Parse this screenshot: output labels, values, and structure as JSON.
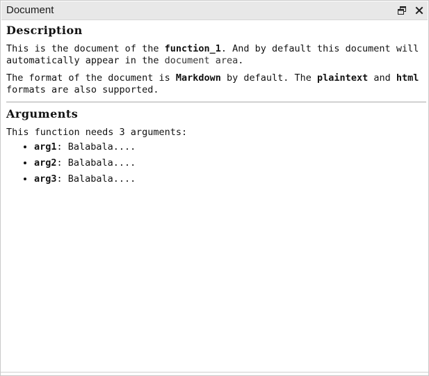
{
  "window": {
    "title": "Document",
    "float_icon": "restore-window-icon",
    "close_icon": "close-icon"
  },
  "doc": {
    "description_heading": "Description",
    "para1": {
      "t1": "This is the document of the ",
      "b1": "function_1",
      "t2": ". And by default this document will automatically appear in the ",
      "c1": "document area",
      "t3": "."
    },
    "para2": {
      "t1": "The format of the document is ",
      "b1": "Markdown",
      "t2": " by default. The ",
      "b2": "plaintext",
      "t3": " and ",
      "b3": "html",
      "t4": " formats are also supported."
    },
    "arguments_heading": "Arguments",
    "args_intro": "This function needs 3 arguments:",
    "args": [
      {
        "name": "arg1",
        "sep": ": ",
        "desc": "Balabala...."
      },
      {
        "name": "arg2",
        "sep": ": ",
        "desc": "Balabala...."
      },
      {
        "name": "arg3",
        "sep": ": ",
        "desc": "Balabala...."
      }
    ]
  },
  "colors": {
    "titlebar_bg": "#e8e8e8",
    "border": "#c9c9c9",
    "divider": "#a8a8a8"
  }
}
